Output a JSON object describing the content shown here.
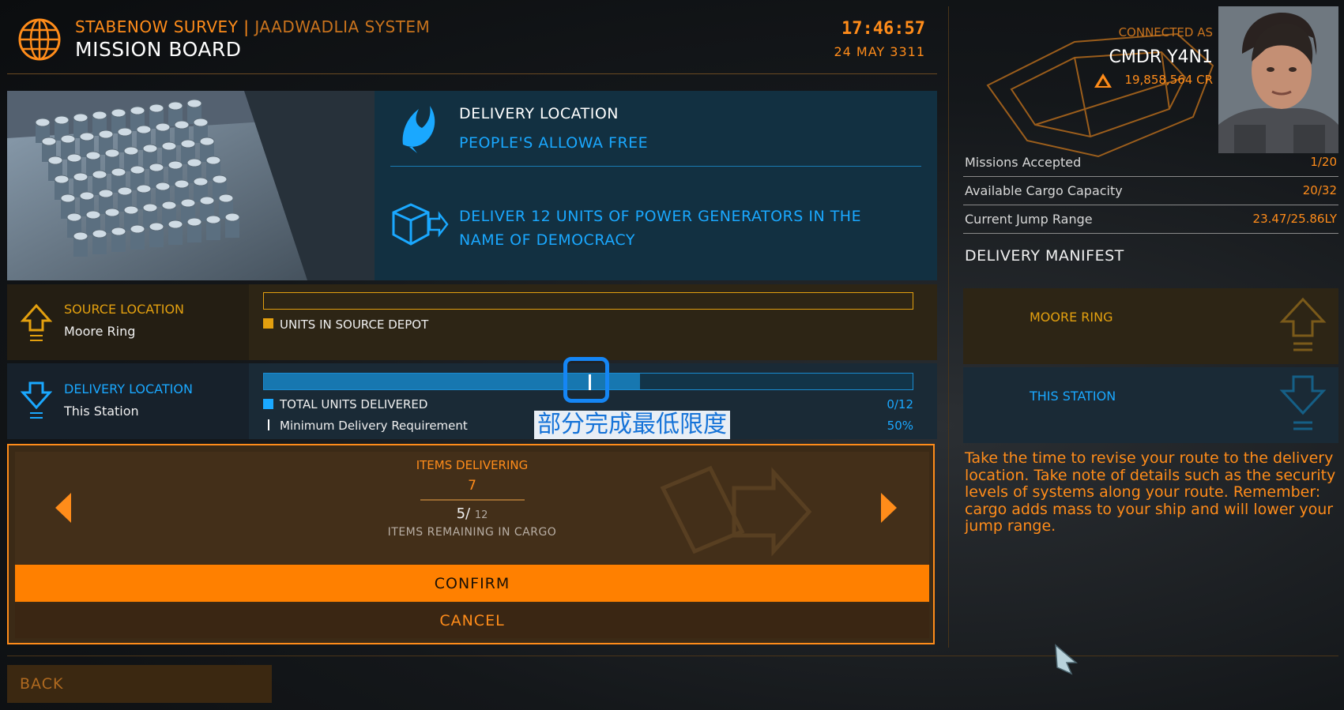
{
  "header": {
    "location_primary": "STABENOW SURVEY",
    "location_sep": "|",
    "location_secondary": "JAADWADLIA SYSTEM",
    "title": "MISSION BOARD",
    "time": "17:46:57",
    "date": "24 MAY 3311",
    "icon": "globe-icon"
  },
  "mission": {
    "delivery_heading": "DELIVERY LOCATION",
    "faction": "PEOPLE'S ALLOWA FREE",
    "objective": "DELIVER 12 UNITS OF POWER GENERATORS IN THE NAME OF DEMOCRACY"
  },
  "source": {
    "label": "SOURCE LOCATION",
    "value": "Moore Ring",
    "legend": "UNITS IN SOURCE DEPOT"
  },
  "delivery": {
    "label": "DELIVERY LOCATION",
    "value": "This Station",
    "legend_total": "TOTAL UNITS DELIVERED",
    "total_value": "0/12",
    "legend_min": "Minimum Delivery Requirement",
    "min_value": "50%",
    "bar_progress_fraction": 0.58,
    "annotation": "部分完成最低限度"
  },
  "items": {
    "heading": "ITEMS DELIVERING",
    "count": "7",
    "remaining_main": "5/",
    "remaining_total": "12",
    "remaining_label": "ITEMS REMAINING IN CARGO"
  },
  "buttons": {
    "confirm": "CONFIRM",
    "cancel": "CANCEL",
    "back": "BACK"
  },
  "commander": {
    "connected_as": "CONNECTED AS",
    "name": "CMDR Y4N1",
    "credits": "19,858,564 CR"
  },
  "stats": [
    {
      "label": "Missions Accepted",
      "value": "1/20"
    },
    {
      "label": "Available Cargo Capacity",
      "value": "20/32"
    },
    {
      "label": "Current Jump Range",
      "value": "23.47/25.86LY"
    }
  ],
  "manifest": {
    "heading": "DELIVERY MANIFEST",
    "source": "MOORE RING",
    "destination": "THIS STATION"
  },
  "description": "Take the time to revise your route to the delivery location. Take note of details such as the security levels of systems along your route. Remember: cargo adds mass to your ship and will lower your jump range.",
  "colors": {
    "orange": "#ff8c1a",
    "blue": "#1aa8ff",
    "yellow": "#e3a00f"
  }
}
